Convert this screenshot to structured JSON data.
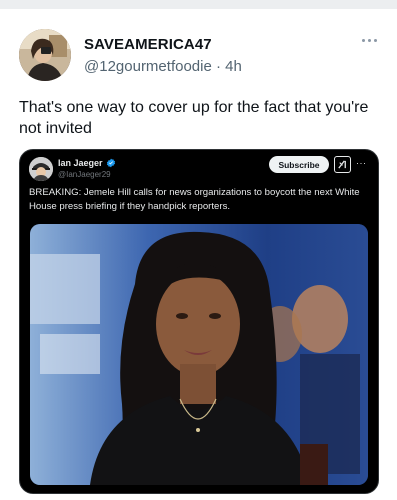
{
  "post": {
    "display_name": "SAVEAMERICA47",
    "handle": "@12gourmetfoodie",
    "separator": "·",
    "time": "4h",
    "text": "That's one way to cover up for the fact that you're not invited"
  },
  "embed": {
    "author_name": "Ian Jaeger",
    "author_handle": "@IanJaeger29",
    "subscribe_label": "Subscribe",
    "more_label": "···",
    "text": "BREAKING: Jemele Hill calls for news organizations to boycott the next White House press briefing if they handpick reporters."
  },
  "colors": {
    "verified": "#1d9bf0",
    "handle_gray": "#536471",
    "embed_bg": "#000000"
  },
  "icons": {
    "more": "more-horizontal-icon",
    "verified": "verified-badge-icon",
    "grok": "grok-icon"
  }
}
